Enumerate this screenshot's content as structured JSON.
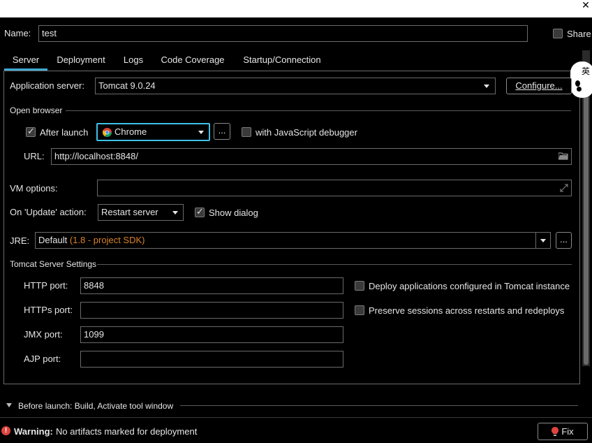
{
  "close_glyph": "✕",
  "name": {
    "label": "Name:",
    "value": "test"
  },
  "share": {
    "label": "Share",
    "checked": false
  },
  "tabs": [
    {
      "label": "Server",
      "active": true
    },
    {
      "label": "Deployment",
      "active": false
    },
    {
      "label": "Logs",
      "active": false
    },
    {
      "label": "Code Coverage",
      "active": false
    },
    {
      "label": "Startup/Connection",
      "active": false
    }
  ],
  "app_server": {
    "label": "Application server:",
    "value": "Tomcat 9.0.24",
    "configure_label": "Configure..."
  },
  "open_browser": {
    "section_title": "Open browser",
    "after_launch_label": "After launch",
    "after_launch_checked": true,
    "browser_value": "Chrome",
    "ellipsis": "...",
    "js_debugger_label": "with JavaScript debugger",
    "js_debugger_checked": false,
    "url_label": "URL:",
    "url_value": "http://localhost:8848/"
  },
  "vm_options": {
    "label": "VM options:",
    "value": ""
  },
  "on_update": {
    "label": "On 'Update' action:",
    "value": "Restart server",
    "show_dialog_label": "Show dialog",
    "show_dialog_checked": true
  },
  "jre": {
    "label": "JRE:",
    "value_main": "Default",
    "value_hint": "(1.8 - project SDK)",
    "ellipsis": "..."
  },
  "tomcat": {
    "section_title": "Tomcat Server Settings",
    "http_label": "HTTP port:",
    "http_value": "8848",
    "https_label": "HTTPs port:",
    "https_value": "",
    "jmx_label": "JMX port:",
    "jmx_value": "1099",
    "ajp_label": "AJP port:",
    "ajp_value": "",
    "deploy_label": "Deploy applications configured in Tomcat instance",
    "deploy_checked": false,
    "preserve_label": "Preserve sessions across restarts and redeploys",
    "preserve_checked": false
  },
  "before_launch": {
    "label": "Before launch: Build, Activate tool window"
  },
  "warning": {
    "prefix": "Warning:",
    "message": "No artifacts marked for deployment",
    "fix_label": "Fix"
  },
  "ime_badge": {
    "char": "英"
  },
  "colors": {
    "focus": "#3fc0e8",
    "tab_underline": "#3fa9d4",
    "warning_red": "#e0443e",
    "hint_orange": "#d9822b"
  }
}
